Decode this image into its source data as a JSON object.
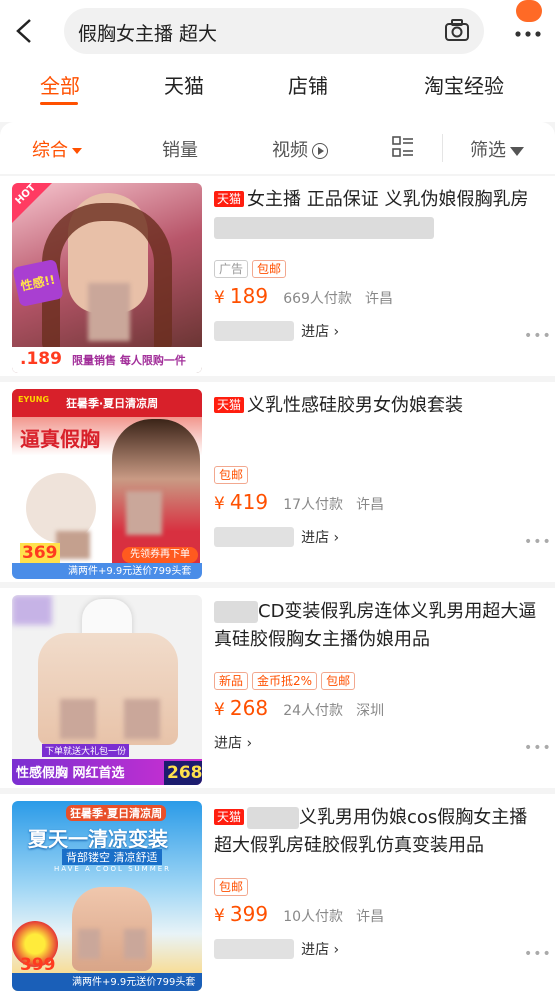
{
  "search": {
    "query": "假胸女主播 超大"
  },
  "tabs": [
    "全部",
    "天猫",
    "店铺",
    "淘宝经验"
  ],
  "filter": {
    "comprehensive": "综合",
    "sales": "销量",
    "video": "视频",
    "screen": "筛选"
  },
  "products": [
    {
      "badge": "天猫",
      "title": "女主播 正品保证 义乳伪娘假胸乳房",
      "tags": [
        "广告",
        "包邮"
      ],
      "price": "189",
      "sales": "669人付款",
      "location": "许昌",
      "shop_link": "进店",
      "thumb_price": "189",
      "thumb_banner": "限量销售 每人限购一件",
      "thumb_badge": "HOT",
      "thumb_sticker": "性感!!"
    },
    {
      "badge": "天猫",
      "title": "义乳性感硅胶男女伪娘套装",
      "tags": [
        "包邮"
      ],
      "price": "419",
      "sales": "17人付款",
      "location": "许昌",
      "shop_link": "进店",
      "thumb_price": "369",
      "thumb_banner": "满两件+9.9元送价799头套",
      "thumb_headline": "逼真假胸",
      "thumb_top": "狂暑季·夏日清凉周",
      "thumb_brand": "EYUNG",
      "thumb_coupon": "先领券再下单"
    },
    {
      "badge": "",
      "title": "CD变装假乳房连体义乳男用超大逼真硅胶假胸女主播伪娘用品",
      "tags": [
        "新品",
        "金币抵2%",
        "包邮"
      ],
      "price": "268",
      "sales": "24人付款",
      "location": "深圳",
      "shop_link": "进店",
      "thumb_price": "268",
      "thumb_banner": "性感假胸 网红首选",
      "thumb_small": "下单就送大礼包一份"
    },
    {
      "badge": "天猫",
      "title": "义乳男用伪娘cos假胸女主播超大假乳房硅胶假乳仿真变装用品",
      "tags": [
        "包邮"
      ],
      "price": "399",
      "sales": "10人付款",
      "location": "许昌",
      "shop_link": "进店",
      "thumb_price": "399",
      "thumb_banner": "满两件+9.9元送价799头套",
      "thumb_headline": "夏天一清凉变装",
      "thumb_top": "狂暑季·夏日清凉周",
      "thumb_sub": "背部镂空 清凉舒适",
      "thumb_en": "HAVE A COOL SUMMER"
    }
  ],
  "colors": {
    "accent": "#ff5000",
    "tmall": "#ff1e0f"
  }
}
